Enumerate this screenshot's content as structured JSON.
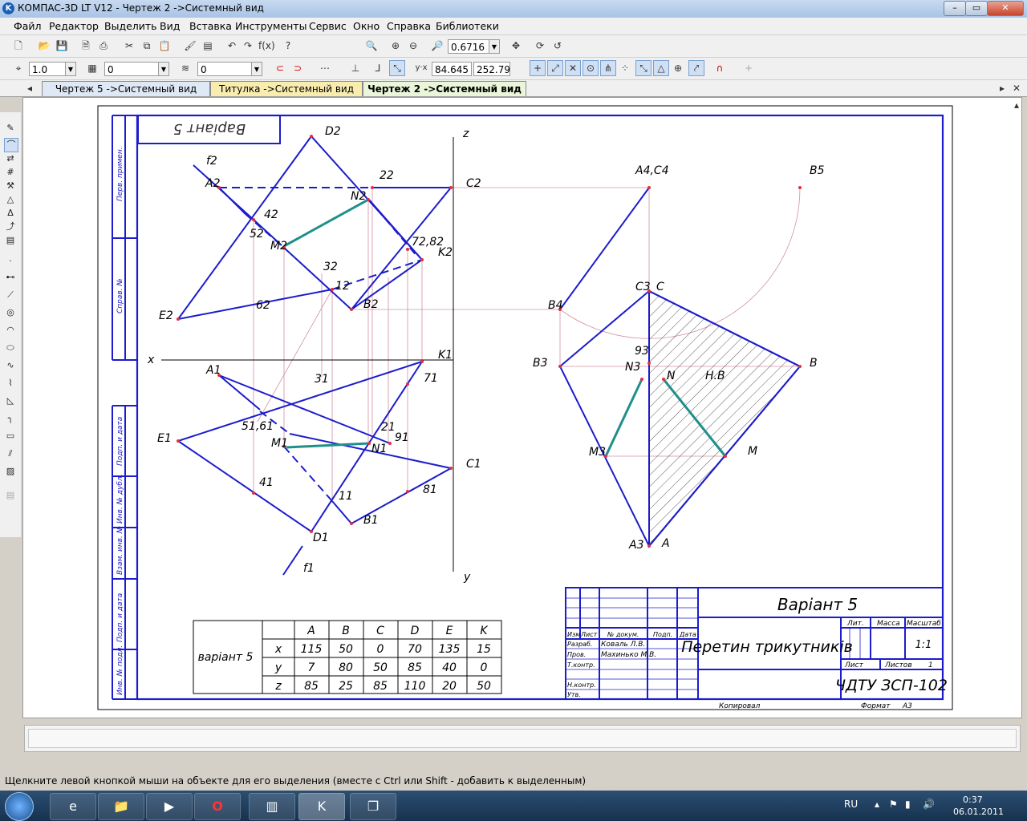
{
  "window": {
    "title": "КОМПАС-3D LT V12 - Чертеж 2 ->Системный вид",
    "app_icon_label": "K"
  },
  "menu": [
    "Файл",
    "Редактор",
    "Выделить",
    "Вид",
    "Вставка",
    "Инструменты",
    "Сервис",
    "Окно",
    "Справка",
    "Библиотеки"
  ],
  "toolbar": {
    "zoom_value": "0.6716",
    "step_value": "1.0",
    "layer_value": "0",
    "style_value": "0",
    "coord_x": "84.645",
    "coord_y": "252.79"
  },
  "tabs": [
    {
      "label": "Чертеж 5 ->Системный вид",
      "active": false
    },
    {
      "label": "Титулка ->Системный вид",
      "active": false
    },
    {
      "label": "Чертеж 2 ->Системный вид",
      "active": true
    }
  ],
  "drawing": {
    "variant_mirrored": "Варіант 5",
    "side_labels": [
      "Перв. примен.",
      "Справ. №",
      "Подп. и дата",
      "Инв. № дубл.",
      "Взам. инв. №",
      "Подп. и дата",
      "Инв. № подл."
    ],
    "projection_labels": {
      "D2": "D2",
      "f2": "f2",
      "A2": "A2",
      "two2": "22",
      "C2": "C2",
      "N2": "N2",
      "four2": "42",
      "five2": "52",
      "M2": "M2",
      "seven2eight2": "72,82",
      "K2": "K2",
      "three2": "32",
      "one2": "12",
      "B2": "B2",
      "E2": "E2",
      "six2": "62",
      "z": "z",
      "x": "x",
      "y": "y",
      "K1": "K1",
      "A1": "A1",
      "three1": "31",
      "seven1": "71",
      "five1six1": "51,61",
      "E1": "E1",
      "M1": "M1",
      "two1": "21",
      "nine1": "91",
      "N1": "N1",
      "C1": "C1",
      "four1": "41",
      "one1": "11",
      "eight1": "81",
      "B1": "B1",
      "D1": "D1",
      "f1": "f1",
      "A4C4": "A4,C4",
      "B5": "B5",
      "C3": "C3",
      "C": "C",
      "B4": "B4",
      "nine3": "93",
      "B3": "B3",
      "N3": "N3",
      "N": "N",
      "NV": "Н.В",
      "B": "B",
      "M3": "M3",
      "M": "M",
      "A3": "A3",
      "A": "A"
    },
    "data_table": {
      "variant": "варіант 5",
      "headers": [
        "A",
        "B",
        "C",
        "D",
        "E",
        "K"
      ],
      "rows": [
        {
          "axis": "x",
          "values": [
            "115",
            "50",
            "0",
            "70",
            "135",
            "15"
          ]
        },
        {
          "axis": "y",
          "values": [
            "7",
            "80",
            "50",
            "85",
            "40",
            "0"
          ]
        },
        {
          "axis": "z",
          "values": [
            "85",
            "25",
            "85",
            "110",
            "20",
            "50"
          ]
        }
      ]
    },
    "title_block": {
      "variant": "Варіант 5",
      "title": "Перетин трикутників",
      "header_cells": [
        "Изм",
        "Лист",
        "№ докум.",
        "Подп.",
        "Дата"
      ],
      "razrab_label": "Разраб.",
      "razrab_name": "Коваль Л.В.",
      "prov_label": "Пров.",
      "prov_name": "Махинько М.В.",
      "tkontr": "Т.контр.",
      "nkontr": "Н.контр.",
      "utv": "Утв.",
      "lit": "Лит.",
      "massa": "Масса",
      "masshtab": "Масштаб",
      "scale_value": "1:1",
      "list": "Лист",
      "listov": "Листов",
      "listov_value": "1",
      "org": "ЧДТУ ЗСП-102",
      "kopiroval": "Копировал",
      "format_label": "Формат",
      "format_value": "А3"
    }
  },
  "status_text": "Щелкните левой кнопкой мыши на объекте для его выделения (вместе с Ctrl или Shift - добавить к выделенным)",
  "tray": {
    "lang": "RU",
    "time": "0:37",
    "date": "06.01.2011"
  }
}
